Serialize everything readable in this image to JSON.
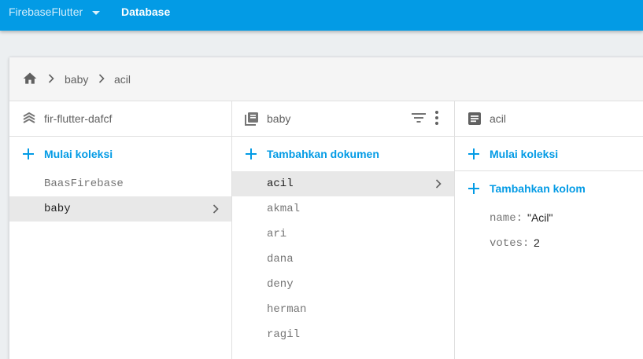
{
  "topbar": {
    "project_name": "FirebaseFlutter",
    "page_title": "Database",
    "bar_color": "#039be5"
  },
  "breadcrumb": {
    "items": [
      "baby",
      "acil"
    ]
  },
  "panels": {
    "root": {
      "title": "fir-flutter-dafcf",
      "action_label": "Mulai koleksi",
      "items": [
        {
          "label": "BaasFirebase",
          "selected": false
        },
        {
          "label": "baby",
          "selected": true
        }
      ]
    },
    "collection": {
      "title": "baby",
      "action_label": "Tambahkan dokumen",
      "items": [
        {
          "label": "acil",
          "selected": true
        },
        {
          "label": "akmal",
          "selected": false
        },
        {
          "label": "ari",
          "selected": false
        },
        {
          "label": "dana",
          "selected": false
        },
        {
          "label": "deny",
          "selected": false
        },
        {
          "label": "herman",
          "selected": false
        },
        {
          "label": "ragil",
          "selected": false
        }
      ]
    },
    "document": {
      "title": "acil",
      "start_collection_label": "Mulai koleksi",
      "add_field_label": "Tambahkan kolom",
      "fields": [
        {
          "key": "name:",
          "value": "\"Acil\""
        },
        {
          "key": "votes:",
          "value": "2"
        }
      ]
    }
  },
  "icons": {
    "home": "home-icon",
    "project": "database-layers-icon",
    "collection": "collection-icon",
    "document": "document-icon",
    "filter": "filter-icon",
    "more": "more-vert-icon",
    "add": "plus-icon",
    "chevron": "chevron-right-icon"
  },
  "accent_color": "#039be5"
}
